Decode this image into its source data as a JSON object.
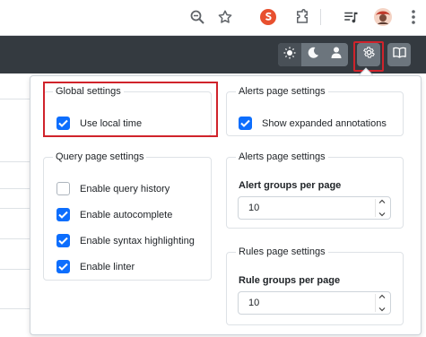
{
  "browser": {
    "icons": [
      "zoom-icon",
      "star-icon",
      "extension-s-icon",
      "puzzle-icon",
      "media-queue-icon",
      "profile-avatar-icon",
      "more-vert-icon"
    ]
  },
  "navbar": {
    "theme_modes": [
      "light",
      "dark",
      "auto"
    ],
    "active_theme": "light",
    "icons": [
      "sun-icon",
      "moon-icon",
      "user-icon",
      "gear-icon",
      "book-icon"
    ]
  },
  "settings": {
    "global": {
      "legend": "Global settings",
      "options": [
        {
          "label": "Use local time",
          "checked": true
        }
      ]
    },
    "query": {
      "legend": "Query page settings",
      "options": [
        {
          "label": "Enable query history",
          "checked": false
        },
        {
          "label": "Enable autocomplete",
          "checked": true
        },
        {
          "label": "Enable syntax highlighting",
          "checked": true
        },
        {
          "label": "Enable linter",
          "checked": true
        }
      ]
    },
    "alerts": {
      "legend": "Alerts page settings",
      "options": [
        {
          "label": "Show expanded annotations",
          "checked": true
        }
      ]
    },
    "alerts_paging": {
      "legend": "Alerts page settings",
      "field_label": "Alert groups per page",
      "value": "10"
    },
    "rules_paging": {
      "legend": "Rules page settings",
      "field_label": "Rule groups per page",
      "value": "10"
    }
  },
  "colors": {
    "accent": "#0d6efd",
    "highlight": "#d0232b",
    "navbar": "#343a40"
  }
}
